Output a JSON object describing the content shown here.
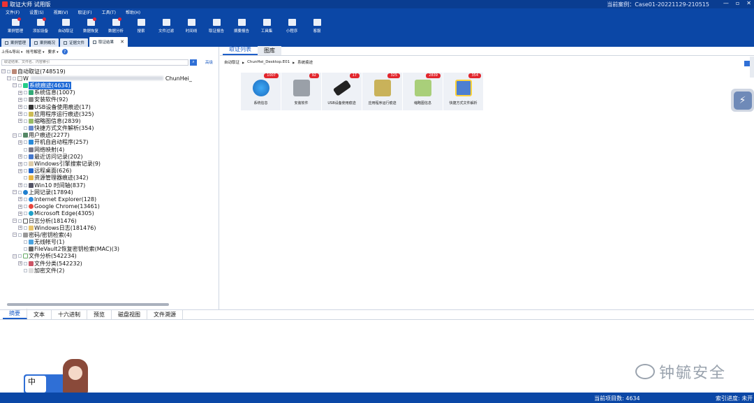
{
  "app": {
    "title": "取证大师 试用版",
    "case": "当前案例：Case01-20221129-210515"
  },
  "menu": [
    "文件(F)",
    "设置(S)",
    "视图(V)",
    "取证(F)",
    "工具(T)",
    "帮助(H)"
  ],
  "toolbar": [
    "案例管理",
    "添加设备",
    "自动取证",
    "数据恢复",
    "数据分析",
    "搜索",
    "文件过滤",
    "时间线",
    "取证报告",
    "摘要报告",
    "工具集",
    "小程序",
    "客服"
  ],
  "doc_tabs": [
    "案例管理",
    "案例概况",
    "证据文件",
    "取证结果"
  ],
  "left": {
    "toolbar": [
      "上传&导出",
      "帐号解密",
      "要求"
    ],
    "search_placeholder": "取证结果、文件名、内容索引",
    "advanced": "高级",
    "tree": [
      {
        "label": "自动取证(748519)"
      },
      {
        "label": "W",
        "suffix": "ChunHei_"
      },
      {
        "label": "系统痕迹(4634)"
      },
      {
        "label": "系统信息(1007)"
      },
      {
        "label": "安装软件(92)"
      },
      {
        "label": "USB设备使用痕迹(17)"
      },
      {
        "label": "应用程序运行痕迹(325)"
      },
      {
        "label": "缩略图信息(2839)"
      },
      {
        "label": "快捷方式文件解析(354)"
      },
      {
        "label": "用户痕迹(2277)"
      },
      {
        "label": "开机自启动程序(257)"
      },
      {
        "label": "网络映射(4)"
      },
      {
        "label": "最近访问记录(202)"
      },
      {
        "label": "Windows引擎搜索记录(9)"
      },
      {
        "label": "远程桌面(626)"
      },
      {
        "label": "资源管理器痕迹(342)"
      },
      {
        "label": "Win10 时间轴(837)"
      },
      {
        "label": "上网记录(17894)"
      },
      {
        "label": "Internet Explorer(128)"
      },
      {
        "label": "Google Chrome(13461)"
      },
      {
        "label": "Microsoft Edge(4305)"
      },
      {
        "label": "日志分析(181476)"
      },
      {
        "label": "Windows日志(181476)"
      },
      {
        "label": "密码/密钥检索(4)"
      },
      {
        "label": "无线帐号(1)"
      },
      {
        "label": "FileVault2恢复密钥检索(MAC)(3)"
      },
      {
        "label": "文件分析(542234)"
      },
      {
        "label": "文件分类(542232)"
      },
      {
        "label": "加密文件(2)"
      }
    ]
  },
  "right": {
    "tabs": [
      "取证列表",
      "图库"
    ],
    "breadcrumb": [
      "自动取证",
      "ChunHei_Desktop.E01",
      "系统痕迹"
    ],
    "cards": [
      {
        "label": "系统信息",
        "badge": "1007"
      },
      {
        "label": "安装软件",
        "badge": "92"
      },
      {
        "label": "USB设备使用痕迹",
        "badge": "17"
      },
      {
        "label": "应用程序运行痕迹",
        "badge": "325"
      },
      {
        "label": "缩略图信息",
        "badge": "2839"
      },
      {
        "label": "快捷方式文件解析",
        "badge": "354"
      }
    ]
  },
  "bottom": {
    "tabs": [
      "摘要",
      "文本",
      "十六进制",
      "预览",
      "磁盘视图",
      "文件溯源"
    ],
    "watermark": "钟毓安全",
    "mascot": "中"
  },
  "status": {
    "items": "当前项目数: 4634",
    "index": "索引进度: 未开"
  }
}
